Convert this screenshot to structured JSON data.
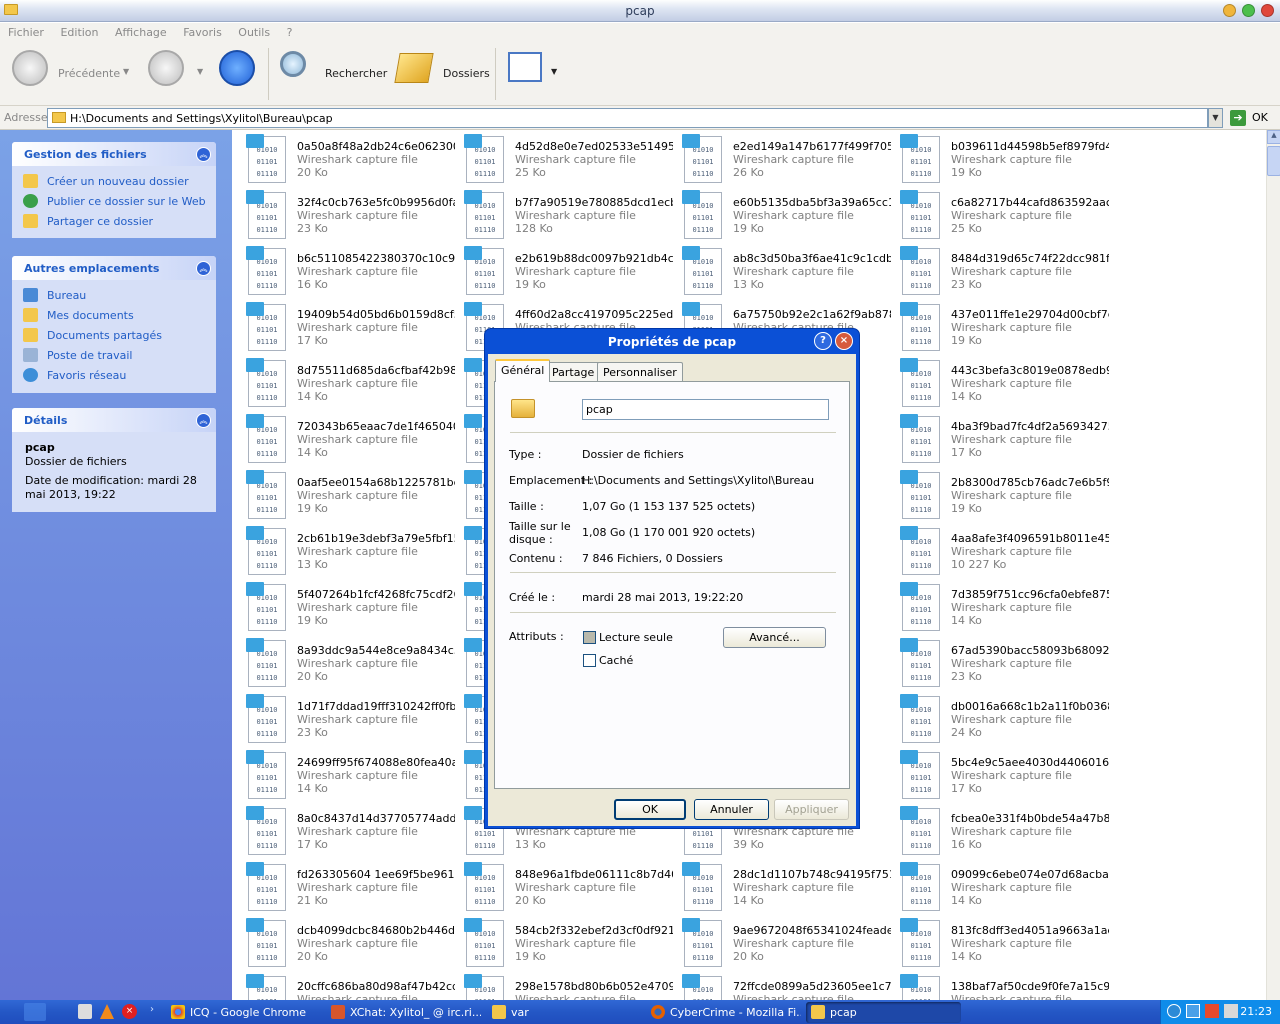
{
  "window": {
    "title": "pcap"
  },
  "menu": [
    "Fichier",
    "Edition",
    "Affichage",
    "Favoris",
    "Outils",
    "?"
  ],
  "toolbar": {
    "back": "Précédente",
    "search": "Rechercher",
    "folders": "Dossiers"
  },
  "address": {
    "label": "Adresse",
    "path": "H:\\Documents and Settings\\Xylitol\\Bureau\\pcap",
    "go": "OK"
  },
  "tasks": {
    "file_tasks": {
      "title": "Gestion des fichiers",
      "items": [
        "Créer un nouveau dossier",
        "Publier ce dossier sur le Web",
        "Partager ce dossier"
      ]
    },
    "other_places": {
      "title": "Autres emplacements",
      "items": [
        "Bureau",
        "Mes documents",
        "Documents partagés",
        "Poste de travail",
        "Favoris réseau"
      ]
    },
    "details": {
      "title": "Détails",
      "name": "pcap",
      "type": "Dossier de fichiers",
      "modified": "Date de modification: mardi 28 mai 2013, 19:22"
    }
  },
  "file_type": "Wireshark capture file",
  "icon_digits": [
    "01010",
    "01101",
    "01110"
  ],
  "files": [
    [
      "0a50a8f48a2db24c6e062300...",
      "20 Ko"
    ],
    [
      "4d52d8e0e7ed02533e514950...",
      "25 Ko"
    ],
    [
      "e2ed149a147b6177f499f705b...",
      "26 Ko"
    ],
    [
      "b039611d44598b5ef8979fd49...",
      "19 Ko"
    ],
    [
      "32f4c0cb763e5fc0b9956d0fac...",
      "23 Ko"
    ],
    [
      "b7f7a90519e780885dcd1ecb6...",
      "128 Ko"
    ],
    [
      "e60b5135dba5bf3a39a65cc1e...",
      "19 Ko"
    ],
    [
      "c6a82717b44cafd863592aaca...",
      "25 Ko"
    ],
    [
      "b6c511085422380370c10c94...",
      "16 Ko"
    ],
    [
      "e2b619b88dc0097b921db4cd...",
      "19 Ko"
    ],
    [
      "ab8c3d50ba3f6ae41c9c1cdb3...",
      "13 Ko"
    ],
    [
      "8484d319d65c74f22dcc981f0...",
      "23 Ko"
    ],
    [
      "19409b54d05bd6b0159d8cf5...",
      "17 Ko"
    ],
    [
      "4ff60d2a8cc4197095c225ed6...",
      ""
    ],
    [
      "6a75750b92e2c1a62f9ab878f...",
      ""
    ],
    [
      "437e011ffe1e29704d00cbf7c...",
      "19 Ko"
    ],
    [
      "8d75511d685da6cfbaf42b98d...",
      "14 Ko"
    ],
    [
      "",
      ""
    ],
    [
      "",
      ""
    ],
    [
      "443c3befa3c8019e0878edb96...",
      "14 Ko"
    ],
    [
      "720343b65eaac7de1f465040...",
      "14 Ko"
    ],
    [
      "",
      ""
    ],
    [
      "",
      ""
    ],
    [
      "4ba3f9bad7fc4df2a56934275...",
      "17 Ko"
    ],
    [
      "0aaf5ee0154a68b1225781bd...",
      "19 Ko"
    ],
    [
      "",
      ""
    ],
    [
      "",
      ""
    ],
    [
      "2b8300d785cb76adc7e6b5f92...",
      "19 Ko"
    ],
    [
      "2cb61b19e3debf3a79e5fbf15...",
      "13 Ko"
    ],
    [
      "",
      ""
    ],
    [
      "",
      ""
    ],
    [
      "4aa8afe3f4096591b8011e456...",
      "10 227 Ko"
    ],
    [
      "5f407264b1fcf4268fc75cdf26...",
      "19 Ko"
    ],
    [
      "",
      ""
    ],
    [
      "",
      ""
    ],
    [
      "7d3859f751cc96cfa0ebfe875...",
      "14 Ko"
    ],
    [
      "8a93ddc9a544e8ce9a8434c5...",
      "20 Ko"
    ],
    [
      "",
      ""
    ],
    [
      "",
      ""
    ],
    [
      "67ad5390bacc58093b680921...",
      "23 Ko"
    ],
    [
      "1d71f7ddad19fff310242ff0fb...",
      "23 Ko"
    ],
    [
      "",
      ""
    ],
    [
      "",
      ""
    ],
    [
      "db0016a668c1b2a11f0b0368...",
      "24 Ko"
    ],
    [
      "24699ff95f674088e80fea40a...",
      "14 Ko"
    ],
    [
      "",
      ""
    ],
    [
      "",
      ""
    ],
    [
      "5bc4e9c5aee4030d4406016b...",
      "17 Ko"
    ],
    [
      "8a0c8437d14d37705774addc...",
      "17 Ko"
    ],
    [
      "",
      "13 Ko"
    ],
    [
      "",
      "39 Ko"
    ],
    [
      "fcbea0e331f4b0bde54a47b8c...",
      "16 Ko"
    ],
    [
      "fd263305604 1ee69f5be96169...",
      "21 Ko"
    ],
    [
      "848e96a1fbde06111c8b7d40...",
      "20 Ko"
    ],
    [
      "28dc1d1107b748c94195f7518...",
      "14 Ko"
    ],
    [
      "09099c6ebe074e07d68acba6...",
      "14 Ko"
    ],
    [
      "dcb4099dcbc84680b2b446de...",
      "20 Ko"
    ],
    [
      "584cb2f332ebef2d3cf0df921c...",
      "19 Ko"
    ],
    [
      "9ae9672048f65341024feadef...",
      "20 Ko"
    ],
    [
      "813fc8dff3ed4051a9663a1ae...",
      "14 Ko"
    ],
    [
      "20cffc686ba80d98af47b42cd...",
      ""
    ],
    [
      "298e1578bd80b6b052e4709e...",
      ""
    ],
    [
      "72ffcde0899a5d23605ee1c7f...",
      ""
    ],
    [
      "138baf7af50cde9f0fe7a15c93...",
      ""
    ]
  ],
  "dialog": {
    "title": "Propriétés de pcap",
    "help": "?",
    "close": "×",
    "tabs": [
      "Général",
      "Partage",
      "Personnaliser"
    ],
    "name": "pcap",
    "rows": [
      {
        "k": "Type :",
        "v": "Dossier de fichiers"
      },
      {
        "k": "Emplacement :",
        "v": "H:\\Documents and Settings\\Xylitol\\Bureau"
      },
      {
        "k": "Taille :",
        "v": "1,07 Go (1 153 137 525 octets)"
      },
      {
        "k": "Taille sur le disque :",
        "v": "1,08 Go (1 170 001 920 octets)"
      },
      {
        "k": "Contenu :",
        "v": "7 846 Fichiers, 0 Dossiers"
      }
    ],
    "created_label": "Créé le :",
    "created_value": "mardi 28 mai 2013, 19:22:20",
    "attributes_label": "Attributs :",
    "readonly": "Lecture seule",
    "hidden": "Caché",
    "advanced": "Avancé...",
    "ok": "OK",
    "cancel": "Annuler",
    "apply": "Appliquer"
  },
  "taskbar": {
    "items": [
      "ICQ - Google Chrome",
      "XChat: Xylitol_ @ irc.ri...",
      "var",
      "CyberCrime - Mozilla Fi...",
      "pcap"
    ],
    "clock": "21:23"
  }
}
